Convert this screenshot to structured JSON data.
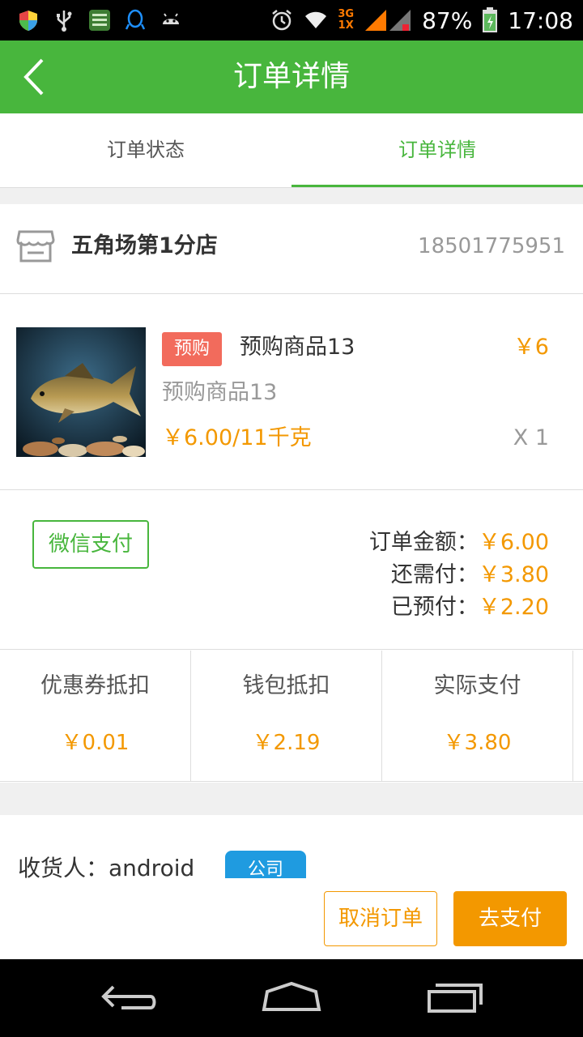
{
  "status_bar": {
    "network_label_top": "3G",
    "network_label_bottom": "1X",
    "battery": "87%",
    "time": "17:08",
    "icons": [
      "shield-icon",
      "usb-icon",
      "app-icon",
      "qq-icon",
      "android-icon",
      "alarm-icon",
      "wifi-icon",
      "signal-icon",
      "battery-icon"
    ]
  },
  "header": {
    "title": "订单详情",
    "back_icon": "chevron-left-icon"
  },
  "tabs": [
    {
      "label": "订单状态",
      "active": false
    },
    {
      "label": "订单详情",
      "active": true
    }
  ],
  "store": {
    "name": "五角场第1分店",
    "phone": "18501775951",
    "icon": "store-icon"
  },
  "product": {
    "badge": "预购",
    "name": "预购商品13",
    "price": "￥6",
    "subtitle": "预购商品13",
    "unit_price": "￥6.00/11千克",
    "quantity": "X 1"
  },
  "payment": {
    "method": "微信支付",
    "lines": [
      {
        "label": "订单金额：",
        "value": "￥6.00"
      },
      {
        "label": "还需付：",
        "value": "￥3.80"
      },
      {
        "label": "已预付：",
        "value": "￥2.20"
      }
    ]
  },
  "deductions": [
    {
      "label": "优惠券抵扣",
      "value": "￥0.01"
    },
    {
      "label": "钱包抵扣",
      "value": "￥2.19"
    },
    {
      "label": "实际支付",
      "value": "￥3.80"
    }
  ],
  "receiver": {
    "label": "收货人：android",
    "tag": "公司"
  },
  "actions": {
    "cancel": "取消订单",
    "pay": "去支付"
  },
  "colors": {
    "brand_green": "#48b63d",
    "price_orange": "#f39800",
    "badge_red": "#f26b5c",
    "tag_blue": "#1f9be0"
  }
}
